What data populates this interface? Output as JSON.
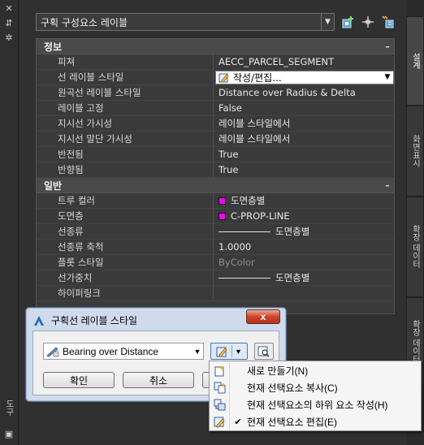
{
  "left_strip": {
    "vertical_label": "도구"
  },
  "header": {
    "selector_value": "구획 구성요소 레이블",
    "toolbar_icons": [
      "add-palette-icon",
      "pick-icon",
      "quick-select-icon"
    ]
  },
  "grid": {
    "categories": [
      {
        "name": "정보",
        "rows": [
          {
            "key": "피쳐",
            "value": "AECC_PARCEL_SEGMENT"
          },
          {
            "key": "선 레이블 스타일",
            "value": "작성/편집..."
          },
          {
            "key": "원곡선 레이블 스타일",
            "value": "Distance over Radius & Delta"
          },
          {
            "key": "레이블 고정",
            "value": "False"
          },
          {
            "key": "지시선 가시성",
            "value": "레이블 스타일에서"
          },
          {
            "key": "지시선 말단 가시성",
            "value": "레이블 스타일에서"
          },
          {
            "key": "반전됨",
            "value": "True"
          },
          {
            "key": "반향됨",
            "value": "True"
          }
        ]
      },
      {
        "name": "일반",
        "rows": [
          {
            "key": "트루 컬러",
            "value": "도면층별"
          },
          {
            "key": "도면층",
            "value": "C-PROP-LINE"
          },
          {
            "key": "선종류",
            "value": "도면층별"
          },
          {
            "key": "선종류 축척",
            "value": "1.0000"
          },
          {
            "key": "플롯 스타일",
            "value": "ByColor"
          },
          {
            "key": "선가중치",
            "value": "도면층별"
          },
          {
            "key": "하이퍼링크",
            "value": ""
          }
        ]
      }
    ],
    "collapse_glyph": "–",
    "swatch_color": "#ff00ff"
  },
  "tabs": [
    "설계",
    "화면표시",
    "확장 데이터",
    "확장 데이터"
  ],
  "dialog": {
    "title": "구획선 레이블 스타일",
    "close_glyph": "x",
    "style_value": "Bearing over Distance",
    "ok_label": "확인",
    "cancel_label": "취소"
  },
  "menu": {
    "items": [
      {
        "label": "새로 만들기(N)",
        "icon": "new-icon",
        "checked": false
      },
      {
        "label": "현재 선택요소 복사(C)",
        "icon": "copy-icon",
        "checked": false
      },
      {
        "label": "현재 선택요소의 하위 요소 작성(H)",
        "icon": "child-icon",
        "checked": false
      },
      {
        "label": "현재 선택요소 편집(E)",
        "icon": "edit-icon",
        "checked": true
      }
    ],
    "check_glyph": "✔"
  }
}
